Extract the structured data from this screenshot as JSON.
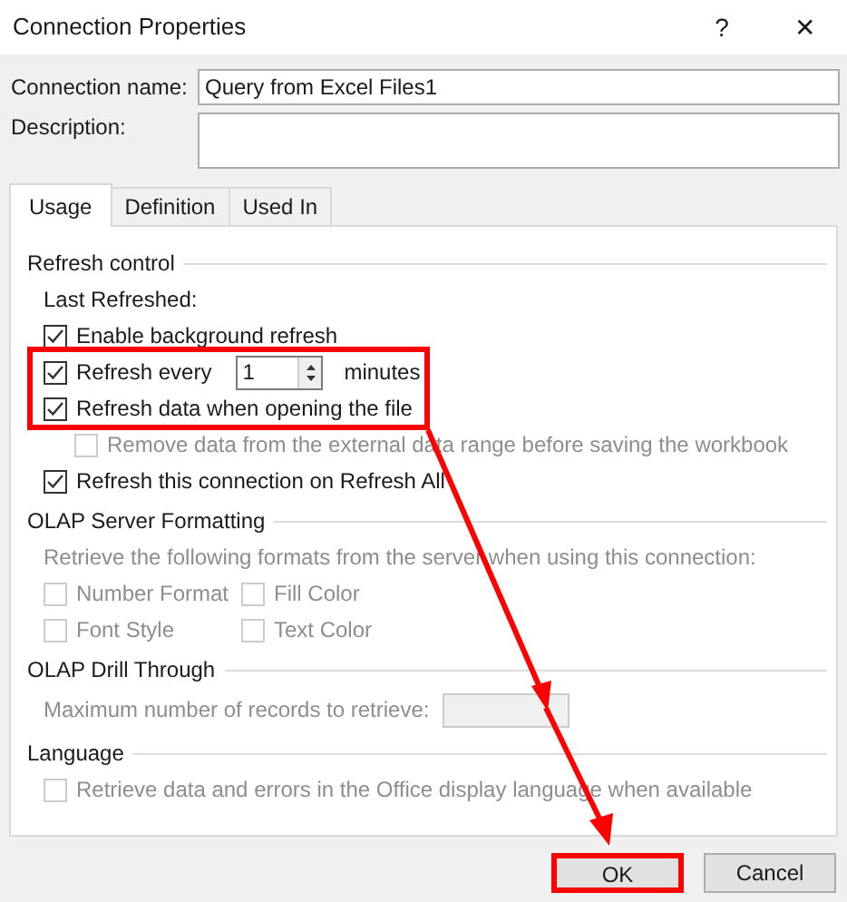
{
  "window": {
    "title": "Connection Properties",
    "help": "?",
    "close": "✕"
  },
  "connection_name": {
    "label": "Connection name:",
    "value": "Query from Excel Files1"
  },
  "description": {
    "label": "Description:"
  },
  "tabs": [
    {
      "label": "Usage",
      "selected": true
    },
    {
      "label": "Definition",
      "selected": false
    },
    {
      "label": "Used In",
      "selected": false
    }
  ],
  "sections": [
    {
      "title": "Refresh control",
      "items": [
        {
          "kind": "text",
          "text": "Last Refreshed:",
          "disabled": false
        },
        {
          "kind": "checkbox",
          "label": "Enable background refresh",
          "checked": true,
          "disabled": false
        },
        {
          "kind": "spin",
          "label": "Refresh every",
          "checked": true,
          "disabled": false,
          "value": "1",
          "unit": "minutes"
        },
        {
          "kind": "checkbox",
          "label": "Refresh data when opening the file",
          "checked": true,
          "disabled": false,
          "children": [
            {
              "label": "Remove data from the external data range before saving the workbook",
              "checked": false,
              "disabled": true
            }
          ]
        },
        {
          "kind": "checkbox",
          "label": "Refresh this connection on Refresh All",
          "checked": true,
          "disabled": false
        }
      ]
    },
    {
      "title": "OLAP Server Formatting",
      "items": [
        {
          "kind": "text",
          "text": "Retrieve the following formats from the server when using this connection:",
          "disabled": true
        },
        {
          "kind": "checkgrid",
          "options": [
            {
              "label": "Number Format",
              "checked": false,
              "disabled": true
            },
            {
              "label": "Fill Color",
              "checked": false,
              "disabled": true
            },
            {
              "label": "Font Style",
              "checked": false,
              "disabled": true
            },
            {
              "label": "Text Color",
              "checked": false,
              "disabled": true
            }
          ]
        }
      ]
    },
    {
      "title": "OLAP Drill Through",
      "items": [
        {
          "kind": "number",
          "label": "Maximum number of records to retrieve:",
          "disabled": true
        }
      ]
    },
    {
      "title": "Language",
      "items": [
        {
          "kind": "checkbox",
          "label": "Retrieve data and errors in the Office display language when available",
          "checked": false,
          "disabled": true
        }
      ]
    }
  ],
  "buttons": [
    {
      "label": "OK",
      "highlighted": true
    },
    {
      "label": "Cancel",
      "highlighted": false
    }
  ]
}
